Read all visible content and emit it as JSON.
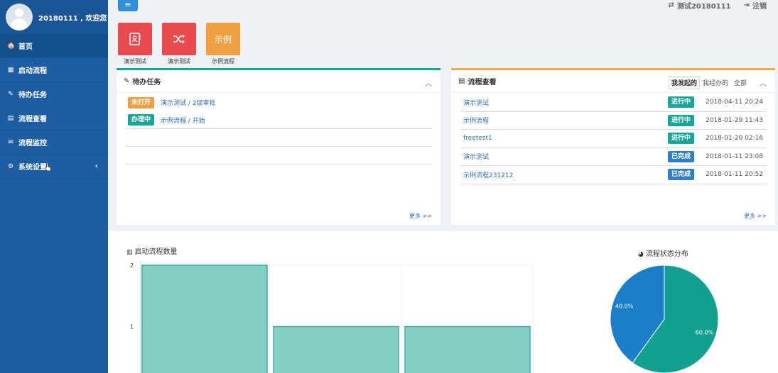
{
  "user": {
    "name": "20180111 , 欢迎您"
  },
  "sidebar": {
    "items": [
      {
        "icon": "home-icon",
        "glyph": "🏠",
        "label": "首页",
        "active": true
      },
      {
        "icon": "grid-icon",
        "glyph": "▦",
        "label": "启动流程",
        "active": false
      },
      {
        "icon": "edit-icon",
        "glyph": "✎",
        "label": "待办任务",
        "active": false
      },
      {
        "icon": "table-icon",
        "glyph": "▤",
        "label": "流程查看",
        "active": false
      },
      {
        "icon": "monitor-icon",
        "glyph": "✉",
        "label": "流程监控",
        "active": false
      },
      {
        "icon": "gear-icon",
        "glyph": "⚙",
        "label": "系统设置",
        "active": false,
        "has_caret": true
      }
    ]
  },
  "topbar": {
    "switch_label": "测试20180111",
    "logout_label": "注销"
  },
  "quick_tiles": [
    {
      "label": "演示测试",
      "color": "#e84a4f",
      "icon": "contact-card-icon",
      "text": ""
    },
    {
      "label": "演示测试",
      "color": "#e84a4f",
      "icon": "shuffle-icon",
      "text": ""
    },
    {
      "label": "示例流程",
      "color": "#f0a040",
      "icon": "",
      "text": "示例"
    }
  ],
  "todo_panel": {
    "title": "待办任务",
    "more": "更多 >>",
    "tasks": [
      {
        "badge": "未打开",
        "badge_color": "orange",
        "text": "演示测试 / 2级审批"
      },
      {
        "badge": "办理中",
        "badge_color": "teal",
        "text": "示例流程 / 开始"
      }
    ]
  },
  "flow_panel": {
    "title": "流程查看",
    "more": "更多 >>",
    "tabs": [
      "我发起的",
      "我经办的",
      "全部"
    ],
    "rows": [
      {
        "name": "演示测试",
        "status": "进行中",
        "status_color": "teal",
        "time": "2018-04-11 20:24"
      },
      {
        "name": "示例流程",
        "status": "进行中",
        "status_color": "teal",
        "time": "2018-01-29 11:43"
      },
      {
        "name": "freetest1",
        "status": "进行中",
        "status_color": "teal",
        "time": "2018-01-20 02:16"
      },
      {
        "name": "演示测试",
        "status": "已完成",
        "status_color": "blue",
        "time": "2018-01-11 23:08"
      },
      {
        "name": "示例流程231212",
        "status": "已完成",
        "status_color": "blue",
        "time": "2018-01-11 20:52"
      }
    ]
  },
  "chart_data": [
    {
      "type": "bar",
      "title": "启动流程数量",
      "values": [
        2,
        1,
        1
      ],
      "ylim": [
        0,
        2
      ],
      "yticks": [
        "2",
        "1"
      ],
      "color": "#86cfc4",
      "grid": true
    },
    {
      "type": "pie",
      "title": "流程状态分布",
      "slices": [
        {
          "label": "60.0%",
          "value": 60,
          "color": "#13a090"
        },
        {
          "label": "40.0%",
          "value": 40,
          "color": "#1a7ec8"
        }
      ]
    }
  ]
}
